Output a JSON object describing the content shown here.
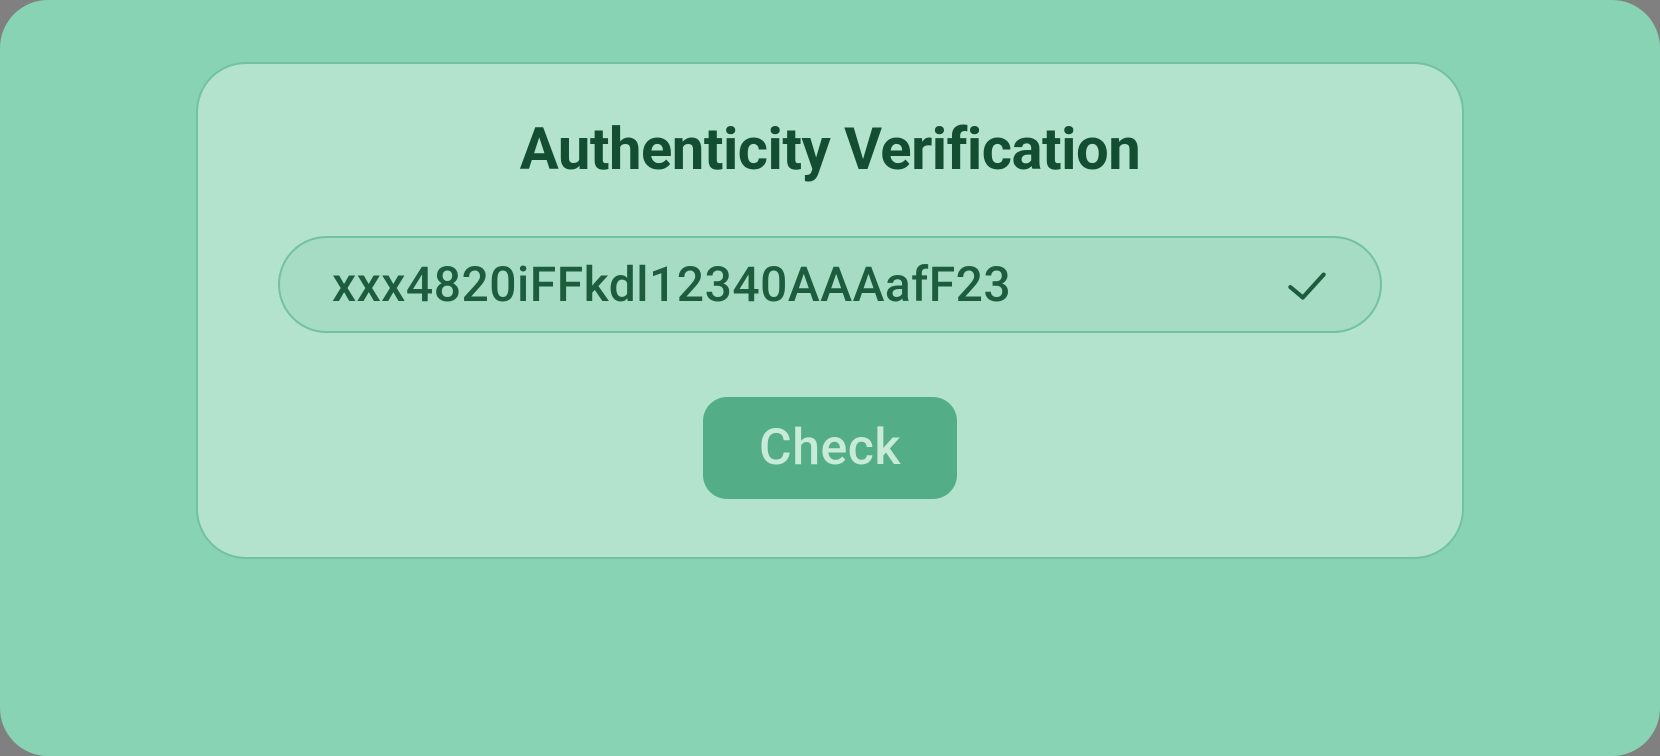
{
  "card": {
    "title": "Authenticity Verification",
    "code_value": "xxx4820iFFkdl12340AAAafF23",
    "check_button_label": "Check",
    "status_icon": "check-icon"
  }
}
